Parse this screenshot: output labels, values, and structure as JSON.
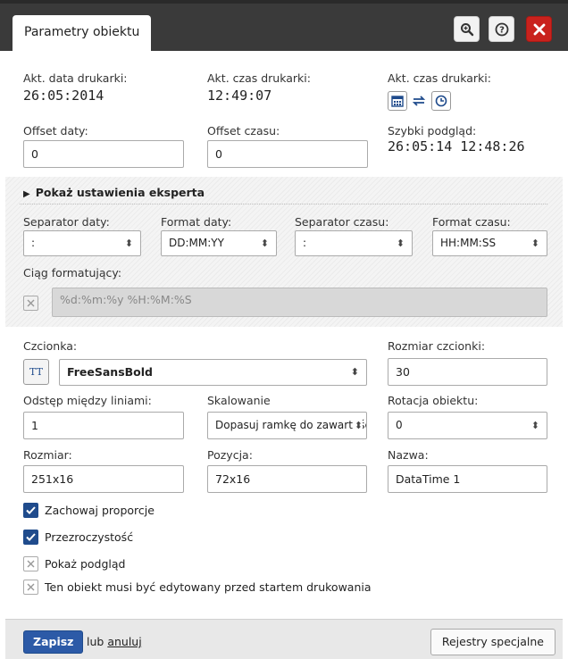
{
  "window": {
    "tab_title": "Parametry obiektu",
    "icons": [
      "zoom-icon",
      "help-icon",
      "close-icon"
    ]
  },
  "printer": {
    "date_label": "Akt. data drukarki:",
    "date_value": "26:05:2014",
    "time_label": "Akt. czas drukarki:",
    "time_value": "12:49:07",
    "time_label2": "Akt. czas drukarki:"
  },
  "offsets": {
    "date_label": "Offset daty:",
    "date_value": "0",
    "time_label": "Offset czasu:",
    "time_value": "0",
    "preview_label": "Szybki podgląd:",
    "preview_value": "26:05:14 12:48:26"
  },
  "expert": {
    "toggle_label": "Pokaż ustawienia eksperta",
    "date_sep_label": "Separator daty:",
    "date_sep_value": ":",
    "date_fmt_label": "Format daty:",
    "date_fmt_value": "DD:MM:YY",
    "time_sep_label": "Separator czasu:",
    "time_sep_value": ":",
    "time_fmt_label": "Format czasu:",
    "time_fmt_value": "HH:MM:SS",
    "format_string_label": "Ciąg formatujący:",
    "format_string_value": "%d:%m:%y %H:%M:%S"
  },
  "font": {
    "label": "Czcionka:",
    "value": "FreeSansBold",
    "icon_text": "TT",
    "size_label": "Rozmiar czcionki:",
    "size_value": "30"
  },
  "layout": {
    "line_spacing_label": "Odstęp między liniami:",
    "line_spacing_value": "1",
    "scaling_label": "Skalowanie",
    "scaling_value": "Dopasuj ramkę do zawartości",
    "rotation_label": "Rotacja obiektu:",
    "rotation_value": "0",
    "size_label": "Rozmiar:",
    "size_value": "251x16",
    "position_label": "Pozycja:",
    "position_value": "72x16",
    "name_label": "Nazwa:",
    "name_value": "DataTime 1"
  },
  "checks": [
    {
      "label": "Zachowaj proporcje",
      "checked": true
    },
    {
      "label": "Przezroczystość",
      "checked": true
    },
    {
      "label": "Pokaż podgląd",
      "checked": false
    },
    {
      "label": "Ten obiekt musi być edytowany przed startem drukowania",
      "checked": false
    }
  ],
  "footer": {
    "save_label": "Zapisz",
    "or_label": "lub",
    "cancel_label": "anuluj",
    "special_label": "Rejestry specjalne"
  },
  "colors": {
    "titlebar": "#3a3a3a",
    "close": "#c9221d",
    "accent": "#2c5aa7",
    "check": "#1f4b8c"
  }
}
